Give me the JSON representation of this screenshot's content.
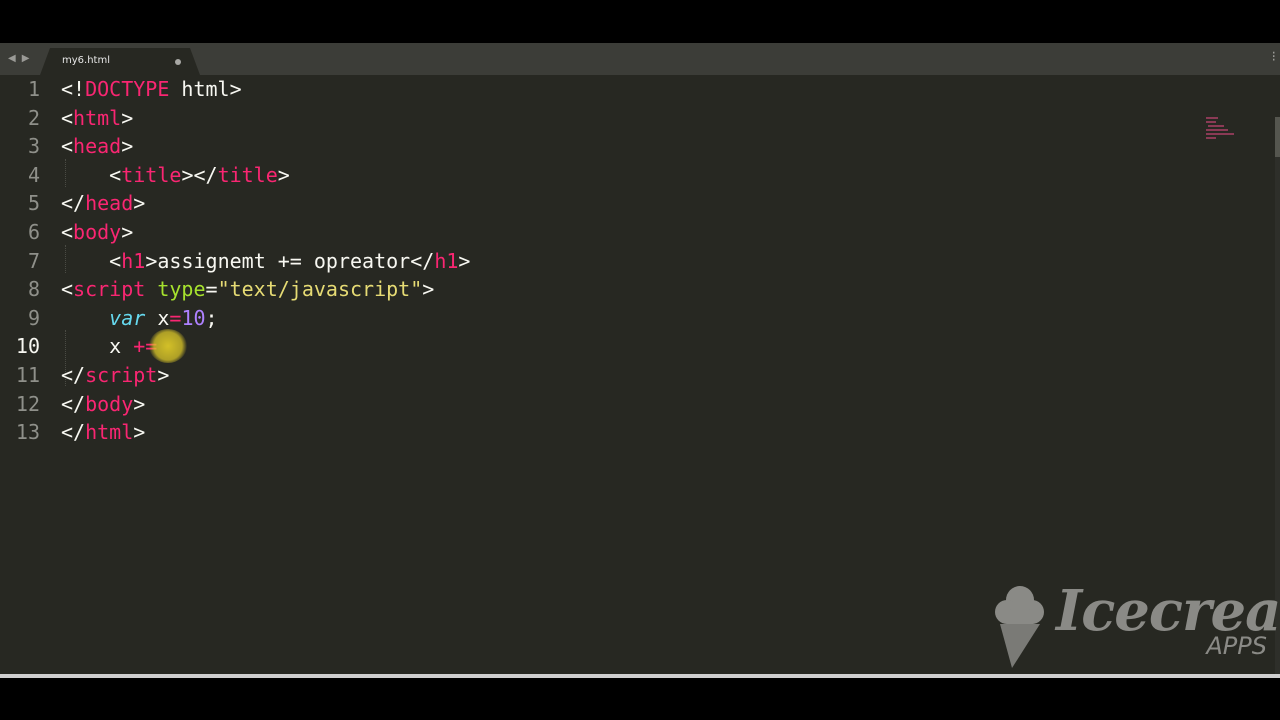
{
  "tab": {
    "title": "my6.html"
  },
  "nav": {
    "back": "◀",
    "forward": "▶"
  },
  "lines": [
    {
      "n": "1",
      "tokens": [
        [
          "tag-punct",
          "<!"
        ],
        [
          "tag",
          "DOCTYPE"
        ],
        [
          "text",
          " html"
        ],
        [
          "tag-punct",
          ">"
        ]
      ]
    },
    {
      "n": "2",
      "tokens": [
        [
          "tag-punct",
          "<"
        ],
        [
          "tag",
          "html"
        ],
        [
          "tag-punct",
          ">"
        ]
      ]
    },
    {
      "n": "3",
      "tokens": [
        [
          "tag-punct",
          "<"
        ],
        [
          "tag",
          "head"
        ],
        [
          "tag-punct",
          ">"
        ]
      ]
    },
    {
      "n": "4",
      "tokens": [
        [
          "text",
          "    "
        ],
        [
          "tag-punct",
          "<"
        ],
        [
          "tag",
          "title"
        ],
        [
          "tag-punct",
          "></"
        ],
        [
          "tag",
          "title"
        ],
        [
          "tag-punct",
          ">"
        ]
      ]
    },
    {
      "n": "5",
      "tokens": [
        [
          "tag-punct",
          "</"
        ],
        [
          "tag",
          "head"
        ],
        [
          "tag-punct",
          ">"
        ]
      ]
    },
    {
      "n": "6",
      "tokens": [
        [
          "tag-punct",
          "<"
        ],
        [
          "tag",
          "body"
        ],
        [
          "tag-punct",
          ">"
        ]
      ]
    },
    {
      "n": "7",
      "tokens": [
        [
          "text",
          "    "
        ],
        [
          "tag-punct",
          "<"
        ],
        [
          "tag",
          "h1"
        ],
        [
          "tag-punct",
          ">"
        ],
        [
          "text",
          "assignemt += opreator"
        ],
        [
          "tag-punct",
          "</"
        ],
        [
          "tag",
          "h1"
        ],
        [
          "tag-punct",
          ">"
        ]
      ]
    },
    {
      "n": "8",
      "tokens": [
        [
          "tag-punct",
          "<"
        ],
        [
          "tag",
          "script"
        ],
        [
          "text",
          " "
        ],
        [
          "attr",
          "type"
        ],
        [
          "punct",
          "="
        ],
        [
          "str",
          "\"text/javascript\""
        ],
        [
          "tag-punct",
          ">"
        ]
      ]
    },
    {
      "n": "9",
      "tokens": [
        [
          "text",
          "    "
        ],
        [
          "kw",
          "var"
        ],
        [
          "text",
          " x"
        ],
        [
          "op",
          "="
        ],
        [
          "num",
          "10"
        ],
        [
          "text",
          ";"
        ]
      ]
    },
    {
      "n": "10",
      "tokens": [
        [
          "text",
          "    x "
        ],
        [
          "op",
          "+="
        ],
        [
          "text",
          " "
        ]
      ]
    },
    {
      "n": "11",
      "tokens": [
        [
          "tag-punct",
          "</"
        ],
        [
          "tag",
          "script"
        ],
        [
          "tag-punct",
          ">"
        ]
      ]
    },
    {
      "n": "12",
      "tokens": [
        [
          "tag-punct",
          "</"
        ],
        [
          "tag",
          "body"
        ],
        [
          "tag-punct",
          ">"
        ]
      ]
    },
    {
      "n": "13",
      "tokens": [
        [
          "tag-punct",
          "</"
        ],
        [
          "tag",
          "html"
        ],
        [
          "tag-punct",
          ">"
        ]
      ]
    }
  ],
  "current_line": "10",
  "watermark": {
    "brand": "Icecream",
    "sub": "APPS"
  },
  "colors": {
    "background": "#272822",
    "tag": "#f92672",
    "attribute": "#a6e22e",
    "string": "#e6db74",
    "number": "#ae81ff",
    "keyword": "#66d9ef",
    "text": "#f8f8f2"
  }
}
